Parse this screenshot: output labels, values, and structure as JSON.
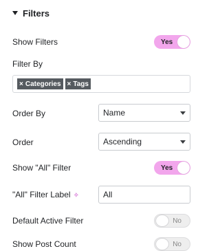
{
  "section": {
    "title": "Filters"
  },
  "show_filters": {
    "label": "Show Filters",
    "toggle_text": "Yes",
    "state": "on"
  },
  "filter_by": {
    "label": "Filter By",
    "tags": [
      {
        "remove_glyph": "×",
        "text": "Categories"
      },
      {
        "remove_glyph": "×",
        "text": "Tags"
      }
    ]
  },
  "order_by": {
    "label": "Order By",
    "selected": "Name"
  },
  "order": {
    "label": "Order",
    "selected": "Ascending"
  },
  "show_all_filter": {
    "label": "Show \"All\" Filter",
    "toggle_text": "Yes",
    "state": "on"
  },
  "all_filter_label": {
    "label": "\"All\" Filter Label",
    "value": "All",
    "ai_icon": "sparkle-icon"
  },
  "default_active_filter": {
    "label": "Default Active Filter",
    "toggle_text": "No",
    "state": "off"
  },
  "show_post_count": {
    "label": "Show Post Count",
    "toggle_text": "No",
    "state": "off"
  },
  "colors": {
    "toggle_on": "#f2a6ec",
    "toggle_off": "#eeeeee",
    "tag_bg": "#555a5f",
    "ai_accent": "#c12fc2"
  }
}
